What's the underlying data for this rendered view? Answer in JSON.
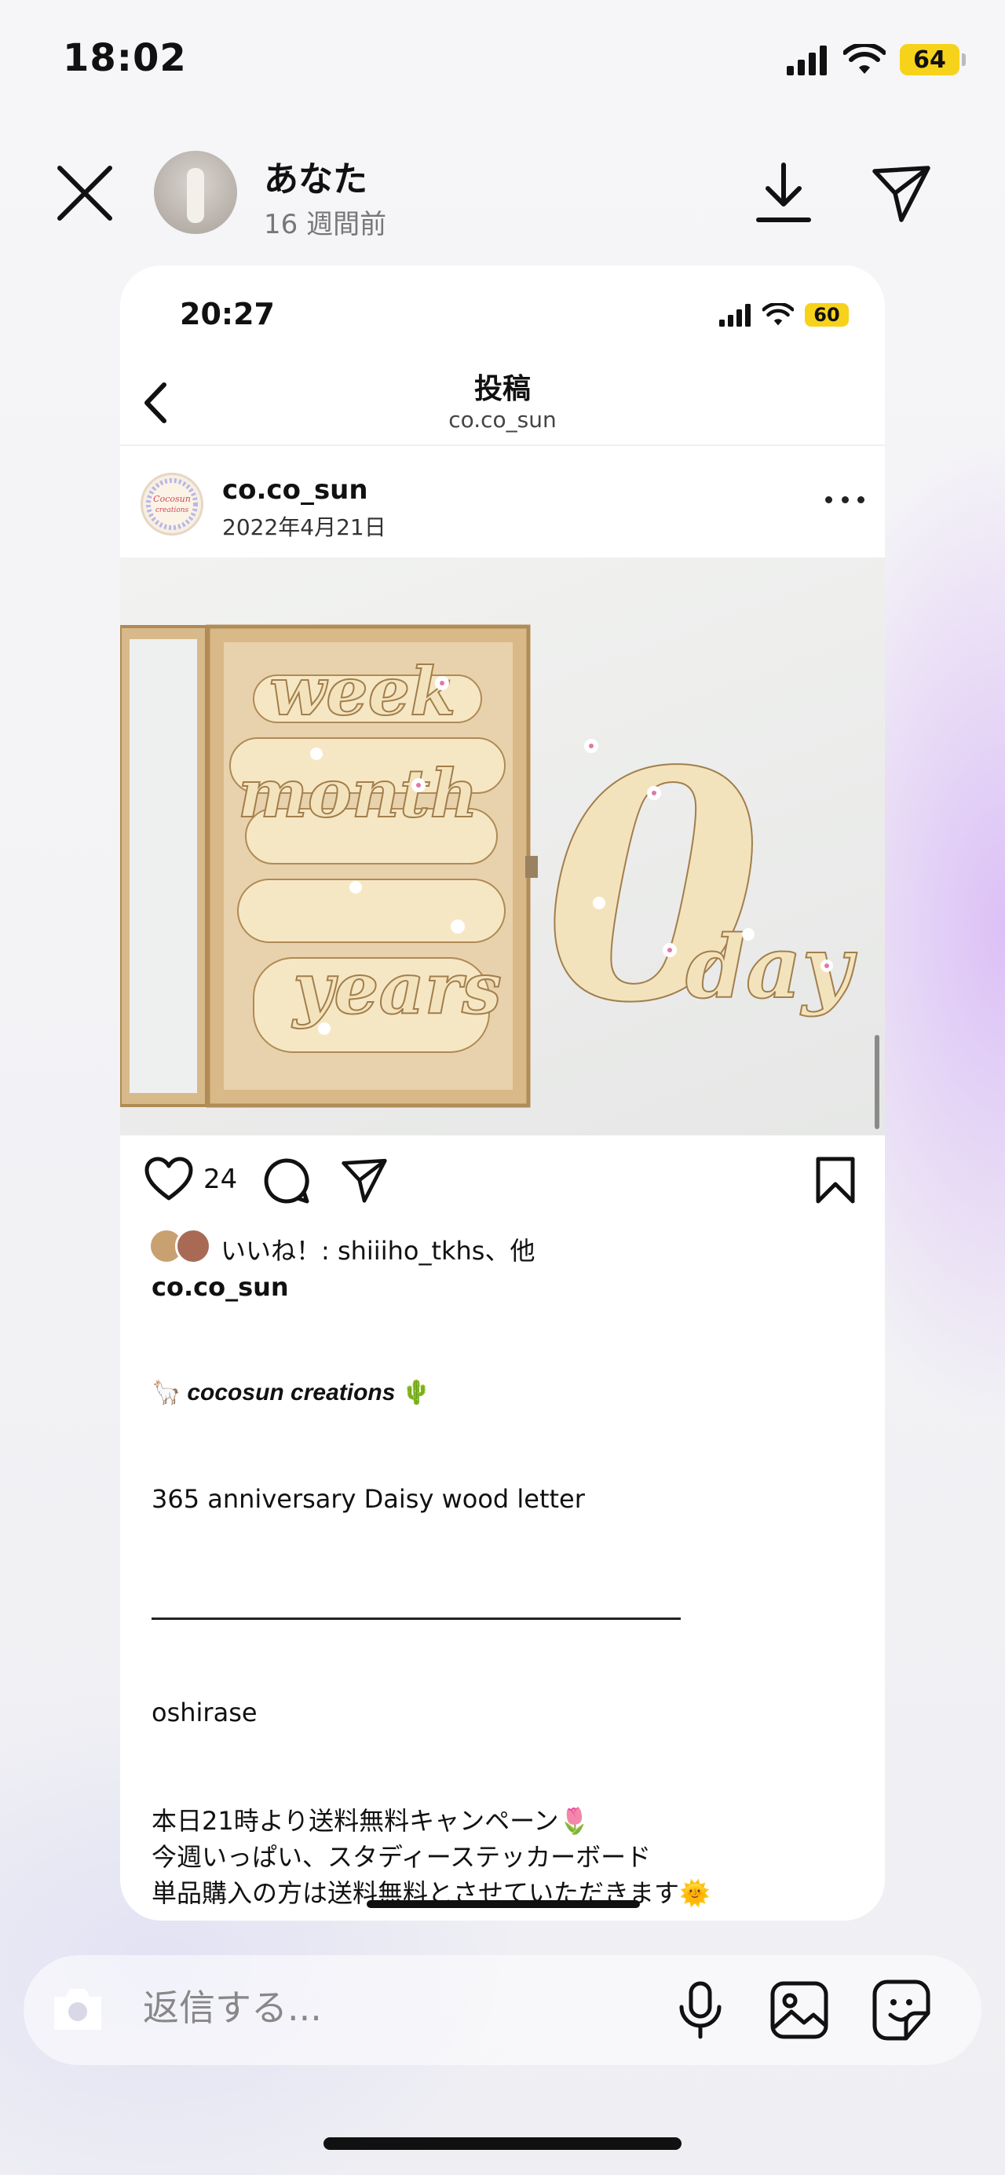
{
  "status_bar": {
    "time": "18:02",
    "battery": "64"
  },
  "story_header": {
    "user_name": "あなた",
    "posted_ago": "16 週間前",
    "icons": [
      "close-icon",
      "download-icon",
      "send-icon"
    ]
  },
  "shared_post": {
    "status_time": "20:27",
    "status_battery": "60",
    "page_title": "投稿",
    "page_subtitle": "co.co_sun",
    "author": "co.co_sun",
    "date": "2022年4月21日",
    "like_count": "24",
    "liked_by": "いいね！: shiiiho_tkhs、他",
    "caption_user": "co.co_sun",
    "brand_line": "cocosun creations",
    "brand_emojis": [
      "🦙",
      "🌵"
    ],
    "caption_lines": [
      "365 anniversary Daisy wood letter",
      "oshirase",
      "本日21時より送料無料キャンペーン🌷",
      "今週いっぱい、スタディーステッカーボード",
      "単品購入の方は送料無料とさせていただきます🌞"
    ],
    "photo_words": [
      "week",
      "month",
      "years",
      "0",
      "day"
    ]
  },
  "reply_bar": {
    "placeholder": "返信する..."
  }
}
